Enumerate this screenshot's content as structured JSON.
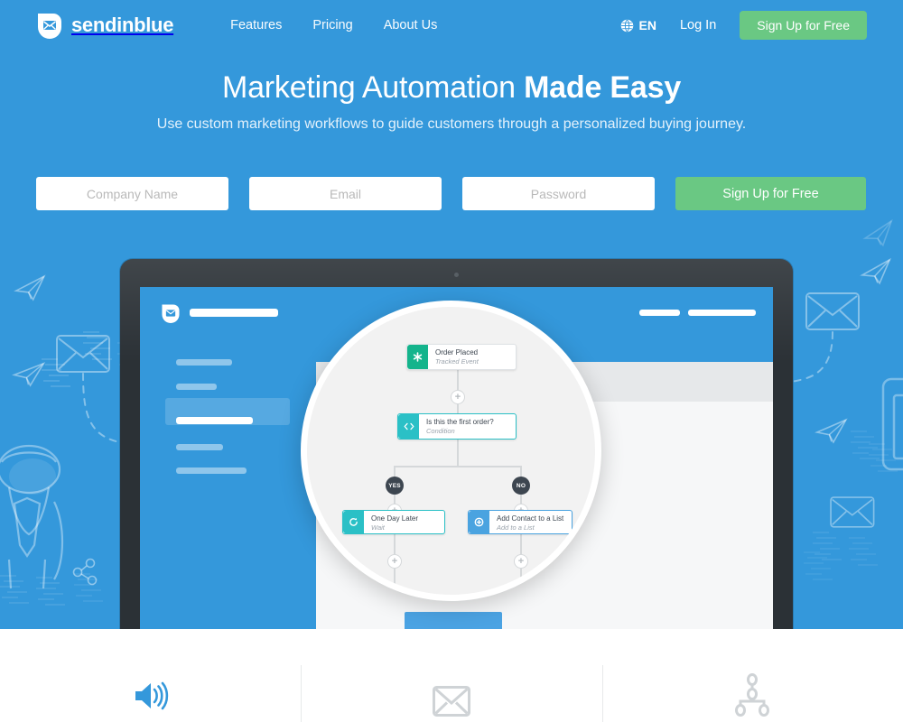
{
  "brand": {
    "name": "sendinblue",
    "logo_icon": "sendinblue-shield-envelope-icon"
  },
  "nav": {
    "links": [
      {
        "label": "Features"
      },
      {
        "label": "Pricing"
      },
      {
        "label": "About Us"
      }
    ],
    "language": {
      "code": "EN",
      "icon": "globe-icon"
    },
    "login_label": "Log In",
    "signup_label": "Sign Up for Free"
  },
  "hero": {
    "title_regular": "Marketing Automation ",
    "title_bold": "Made Easy",
    "subtitle": "Use custom marketing workflows to guide customers through a personalized buying journey."
  },
  "signup_form": {
    "company_placeholder": "Company Name",
    "company_value": "",
    "email_placeholder": "Email",
    "email_value": "",
    "password_placeholder": "Password",
    "password_value": "",
    "submit_label": "Sign Up for Free"
  },
  "workflow": {
    "nodes": [
      {
        "title": "Order Placed",
        "subtitle": "Tracked Event",
        "icon": "asterisk-icon",
        "color": "#14b48c"
      },
      {
        "title": "Is this the first order?",
        "subtitle": "Condition",
        "icon": "code-brackets-icon",
        "color": "#2bc0c6"
      },
      {
        "title": "One Day Later",
        "subtitle": "Wait",
        "icon": "clock-refresh-icon",
        "color": "#2bc0c6"
      },
      {
        "title": "Add Contact to a List",
        "subtitle": "Add to a List",
        "icon": "plus-circle-icon",
        "color": "#4aa3e0"
      }
    ],
    "branch_yes": "YES",
    "branch_no": "NO",
    "add_step_glyph": "+"
  },
  "features": [
    {
      "icon": "megaphone-speaker-icon",
      "color": "#3498db"
    },
    {
      "icon": "envelope-icon",
      "color": "#cfd3d6"
    },
    {
      "icon": "workflow-sitemap-icon",
      "color": "#cfd3d6"
    }
  ],
  "colors": {
    "brand_blue": "#3498db",
    "accent_green": "#6ac883",
    "laptop_bezel": "#2b3136",
    "panel_gray": "#f6f7f8",
    "teal": "#2bc0c6",
    "green_node": "#14b48c"
  }
}
